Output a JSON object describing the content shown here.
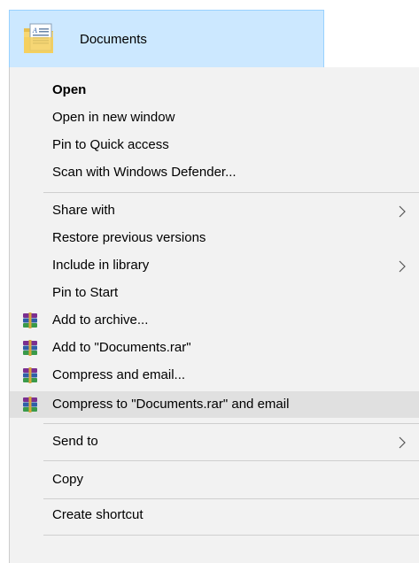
{
  "folder": {
    "name": "Documents",
    "icon": "documents-folder-icon"
  },
  "menu": {
    "items": [
      {
        "label": "Open",
        "bold": true
      },
      {
        "label": "Open in new window"
      },
      {
        "label": "Pin to Quick access"
      },
      {
        "label": "Scan with Windows Defender..."
      },
      {
        "label": "Share with",
        "submenu": true
      },
      {
        "label": "Restore previous versions"
      },
      {
        "label": "Include in library",
        "submenu": true
      },
      {
        "label": "Pin to Start"
      },
      {
        "label": "Add to archive...",
        "icon": "winrar-archive-icon"
      },
      {
        "label": "Add to \"Documents.rar\"",
        "icon": "winrar-archive-icon"
      },
      {
        "label": "Compress and email...",
        "icon": "winrar-archive-icon"
      },
      {
        "label": "Compress to \"Documents.rar\" and email",
        "icon": "winrar-archive-icon",
        "highlighted": true
      },
      {
        "label": "Send to",
        "submenu": true
      },
      {
        "label": "Copy"
      },
      {
        "label": "Create shortcut"
      }
    ]
  },
  "colors": {
    "selection_fill": "#cce8ff",
    "selection_border": "#99d1ff",
    "menu_background": "#f2f2f2",
    "hover_background": "#e0e0e0",
    "separator": "#cfcfcf"
  }
}
